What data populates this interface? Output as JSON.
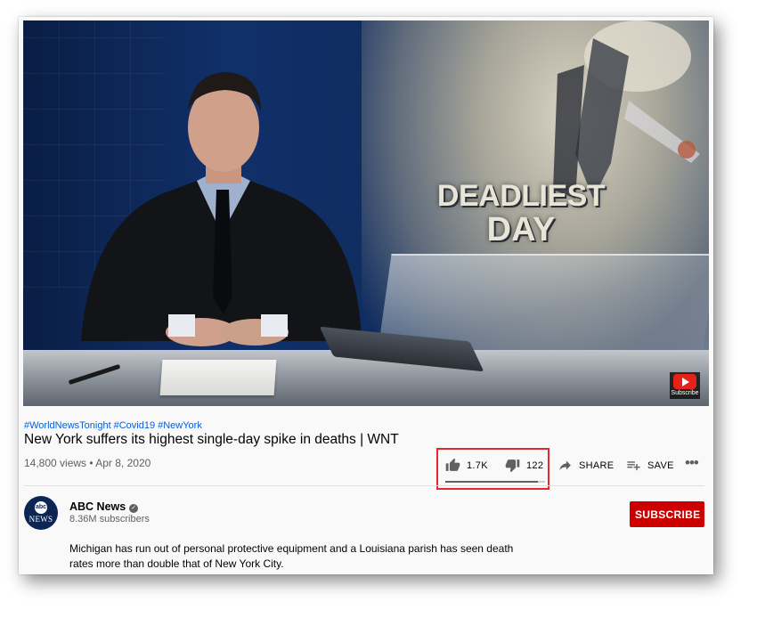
{
  "video": {
    "headline_line1": "DEADLIEST",
    "headline_line2": "DAY",
    "watermark_caption": "Subscribe"
  },
  "hashtags": [
    "#WorldNewsTonight",
    "#Covid19",
    "#NewYork"
  ],
  "title": "New York suffers its highest single-day spike in deaths | WNT",
  "meta": "14,800 views • Apr 8, 2020",
  "actions": {
    "like_count": "1.7K",
    "dislike_count": "122",
    "share_label": "SHARE",
    "save_label": "SAVE",
    "more_label": "•••"
  },
  "sentiment": {
    "like_ratio": 0.93
  },
  "channel": {
    "avatar_top": "abc",
    "avatar_bottom": "NEWS",
    "name": "ABC News",
    "verified_mark": "✓",
    "subscribers": "8.36M subscribers",
    "subscribe_label": "SUBSCRIBE"
  },
  "description": "Michigan has run out of personal protective equipment and a Louisiana parish has seen death rates more than double that of New York City.",
  "colors": {
    "link": "#065fd4",
    "subscribe": "#cc0000",
    "highlight": "#e3292c"
  },
  "icons": [
    "thumb-up-icon",
    "thumb-down-icon",
    "share-icon",
    "playlist-add-icon",
    "more-icon",
    "youtube-logo-icon",
    "verified-icon"
  ]
}
